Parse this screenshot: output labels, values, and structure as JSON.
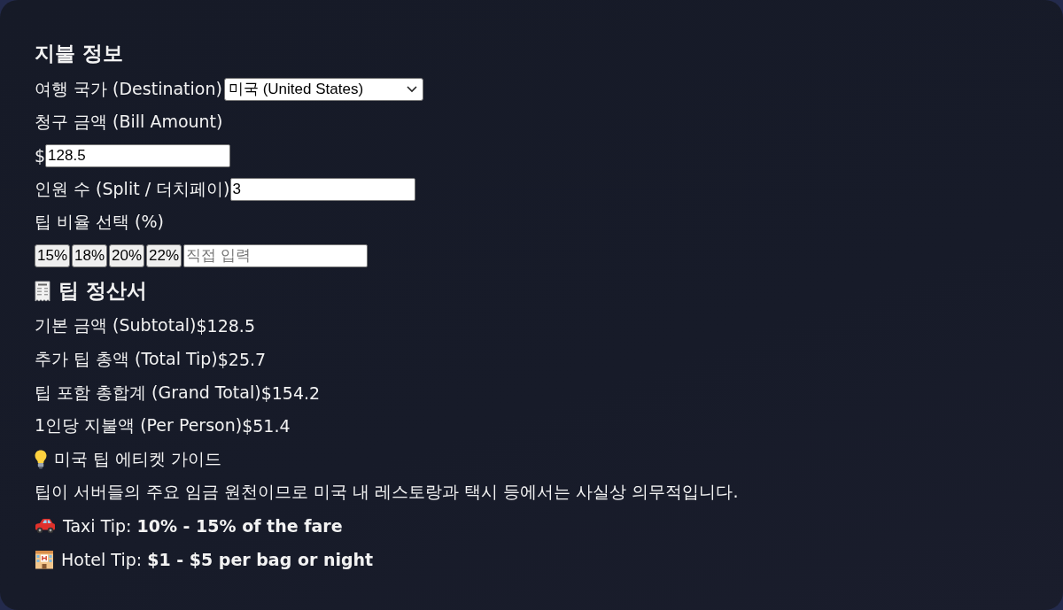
{
  "payment_section": {
    "title": "지불 정보",
    "destination": {
      "label": "여행 국가 (Destination)",
      "value": "미국 (United States)"
    },
    "bill_amount": {
      "label": "청구 금액 (Bill Amount)",
      "prefix": "$",
      "value": "128.5"
    },
    "split": {
      "label": "인원 수 (Split / 더치페이)",
      "value": "3"
    },
    "tip_rate": {
      "label": "팁 비율 선택 (%)",
      "options": [
        {
          "label": "15%",
          "selected": false
        },
        {
          "label": "18%",
          "selected": false
        },
        {
          "label": "20%",
          "selected": false
        },
        {
          "label": "22%",
          "selected": false
        }
      ],
      "custom": {
        "placeholder": "직접 입력"
      }
    }
  },
  "receipt": {
    "title": "팁 정산서",
    "rows": [
      {
        "label": "기본 금액 (Subtotal)",
        "value": "$128.5"
      },
      {
        "label": "추가 팁 총액 (Total Tip)",
        "value": "$25.7"
      },
      {
        "label": "팁 포함 총합계 (Grand Total)",
        "value": "$154.2"
      },
      {
        "label": "1인당 지불액 (Per Person)",
        "value": "$51.4"
      }
    ]
  },
  "guide": {
    "title": "미국 팁 에티켓 가이드",
    "description": "팁이 서버들의 주요 임금 원천이므로 미국 내 레스토랑과 택시 등에서는 사실상 의무적입니다.",
    "tips": [
      {
        "kind": "taxi",
        "text": "Taxi Tip: **10% - 15% of the fare**"
      },
      {
        "kind": "hotel",
        "text": "Hotel Tip: **$1 - $5 per bag or night**"
      }
    ]
  }
}
